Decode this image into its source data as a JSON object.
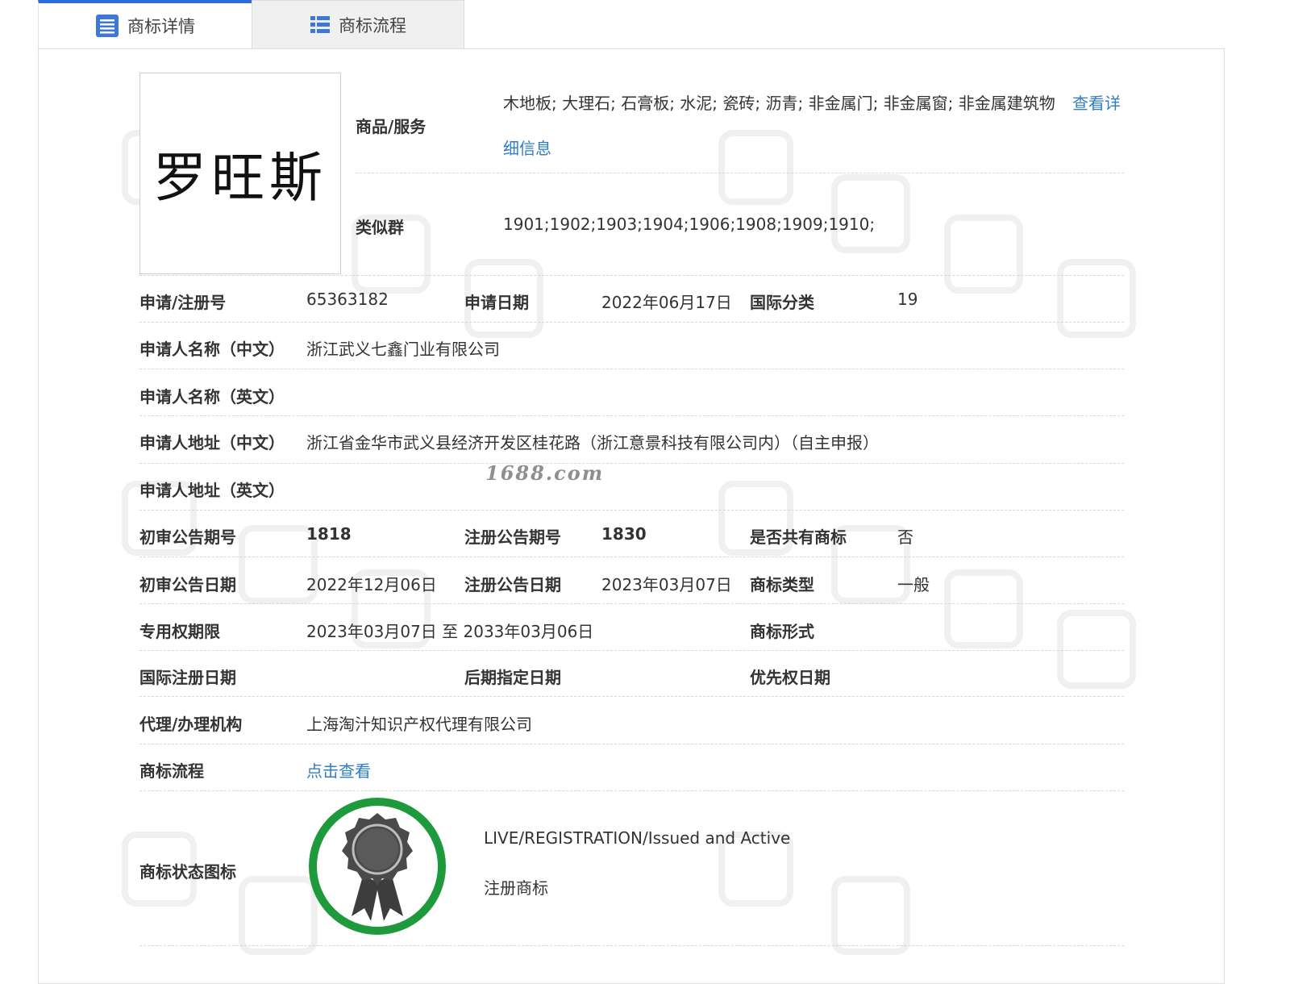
{
  "tabs": [
    {
      "label": "商标详情",
      "active": true
    },
    {
      "label": "商标流程",
      "active": false
    }
  ],
  "logo": {
    "text": "罗旺斯"
  },
  "goods": {
    "label": "商品/服务",
    "text": "木地板; 大理石; 石膏板; 水泥; 瓷砖; 沥青; 非金属门; 非金属窗; 非金属建筑物",
    "more_link_part1": "查看详",
    "more_link_part2": "细信息"
  },
  "similar_group": {
    "label": "类似群",
    "value": "1901;1902;1903;1904;1906;1908;1909;1910;"
  },
  "rows": {
    "reg_no": {
      "label": "申请/注册号",
      "value": "65363182"
    },
    "app_date": {
      "label": "申请日期",
      "value": "2022年06月17日"
    },
    "intl_class": {
      "label": "国际分类",
      "value": "19"
    },
    "applicant_cn": {
      "label": "申请人名称（中文）",
      "value": "浙江武义七鑫门业有限公司"
    },
    "applicant_en": {
      "label": "申请人名称（英文）",
      "value": ""
    },
    "address_cn": {
      "label": "申请人地址（中文）",
      "value": "浙江省金华市武义县经济开发区桂花路（浙江意景科技有限公司内）（自主申报）"
    },
    "address_en": {
      "label": "申请人地址（英文）",
      "value": ""
    },
    "prelim_no": {
      "label": "初审公告期号",
      "value": "1818"
    },
    "reg_pub_no": {
      "label": "注册公告期号",
      "value": "1830"
    },
    "shared": {
      "label": "是否共有商标",
      "value": "否"
    },
    "prelim_date": {
      "label": "初审公告日期",
      "value": "2022年12月06日"
    },
    "reg_pub_date": {
      "label": "注册公告日期",
      "value": "2023年03月07日"
    },
    "tm_type": {
      "label": "商标类型",
      "value": "一般"
    },
    "exclusive": {
      "label": "专用权期限",
      "value": "2023年03月07日 至 2033年03月06日"
    },
    "tm_form": {
      "label": "商标形式",
      "value": ""
    },
    "intl_reg_date": {
      "label": "国际注册日期",
      "value": ""
    },
    "later_date": {
      "label": "后期指定日期",
      "value": ""
    },
    "priority_date": {
      "label": "优先权日期",
      "value": ""
    },
    "agency": {
      "label": "代理/办理机构",
      "value": "上海淘汁知识产权代理有限公司"
    },
    "flow": {
      "label": "商标流程",
      "value": "点击查看"
    }
  },
  "status": {
    "label": "商标状态图标",
    "status_en": "LIVE/REGISTRATION/Issued and Active",
    "status_cn": "注册商标"
  },
  "watermark": {
    "stamp": "1688.com"
  },
  "colors": {
    "accent": "#2f6bd8",
    "link": "#2f7cc7",
    "badge_ring": "#1e9a3c",
    "badge_dark": "#3d3d3d"
  }
}
